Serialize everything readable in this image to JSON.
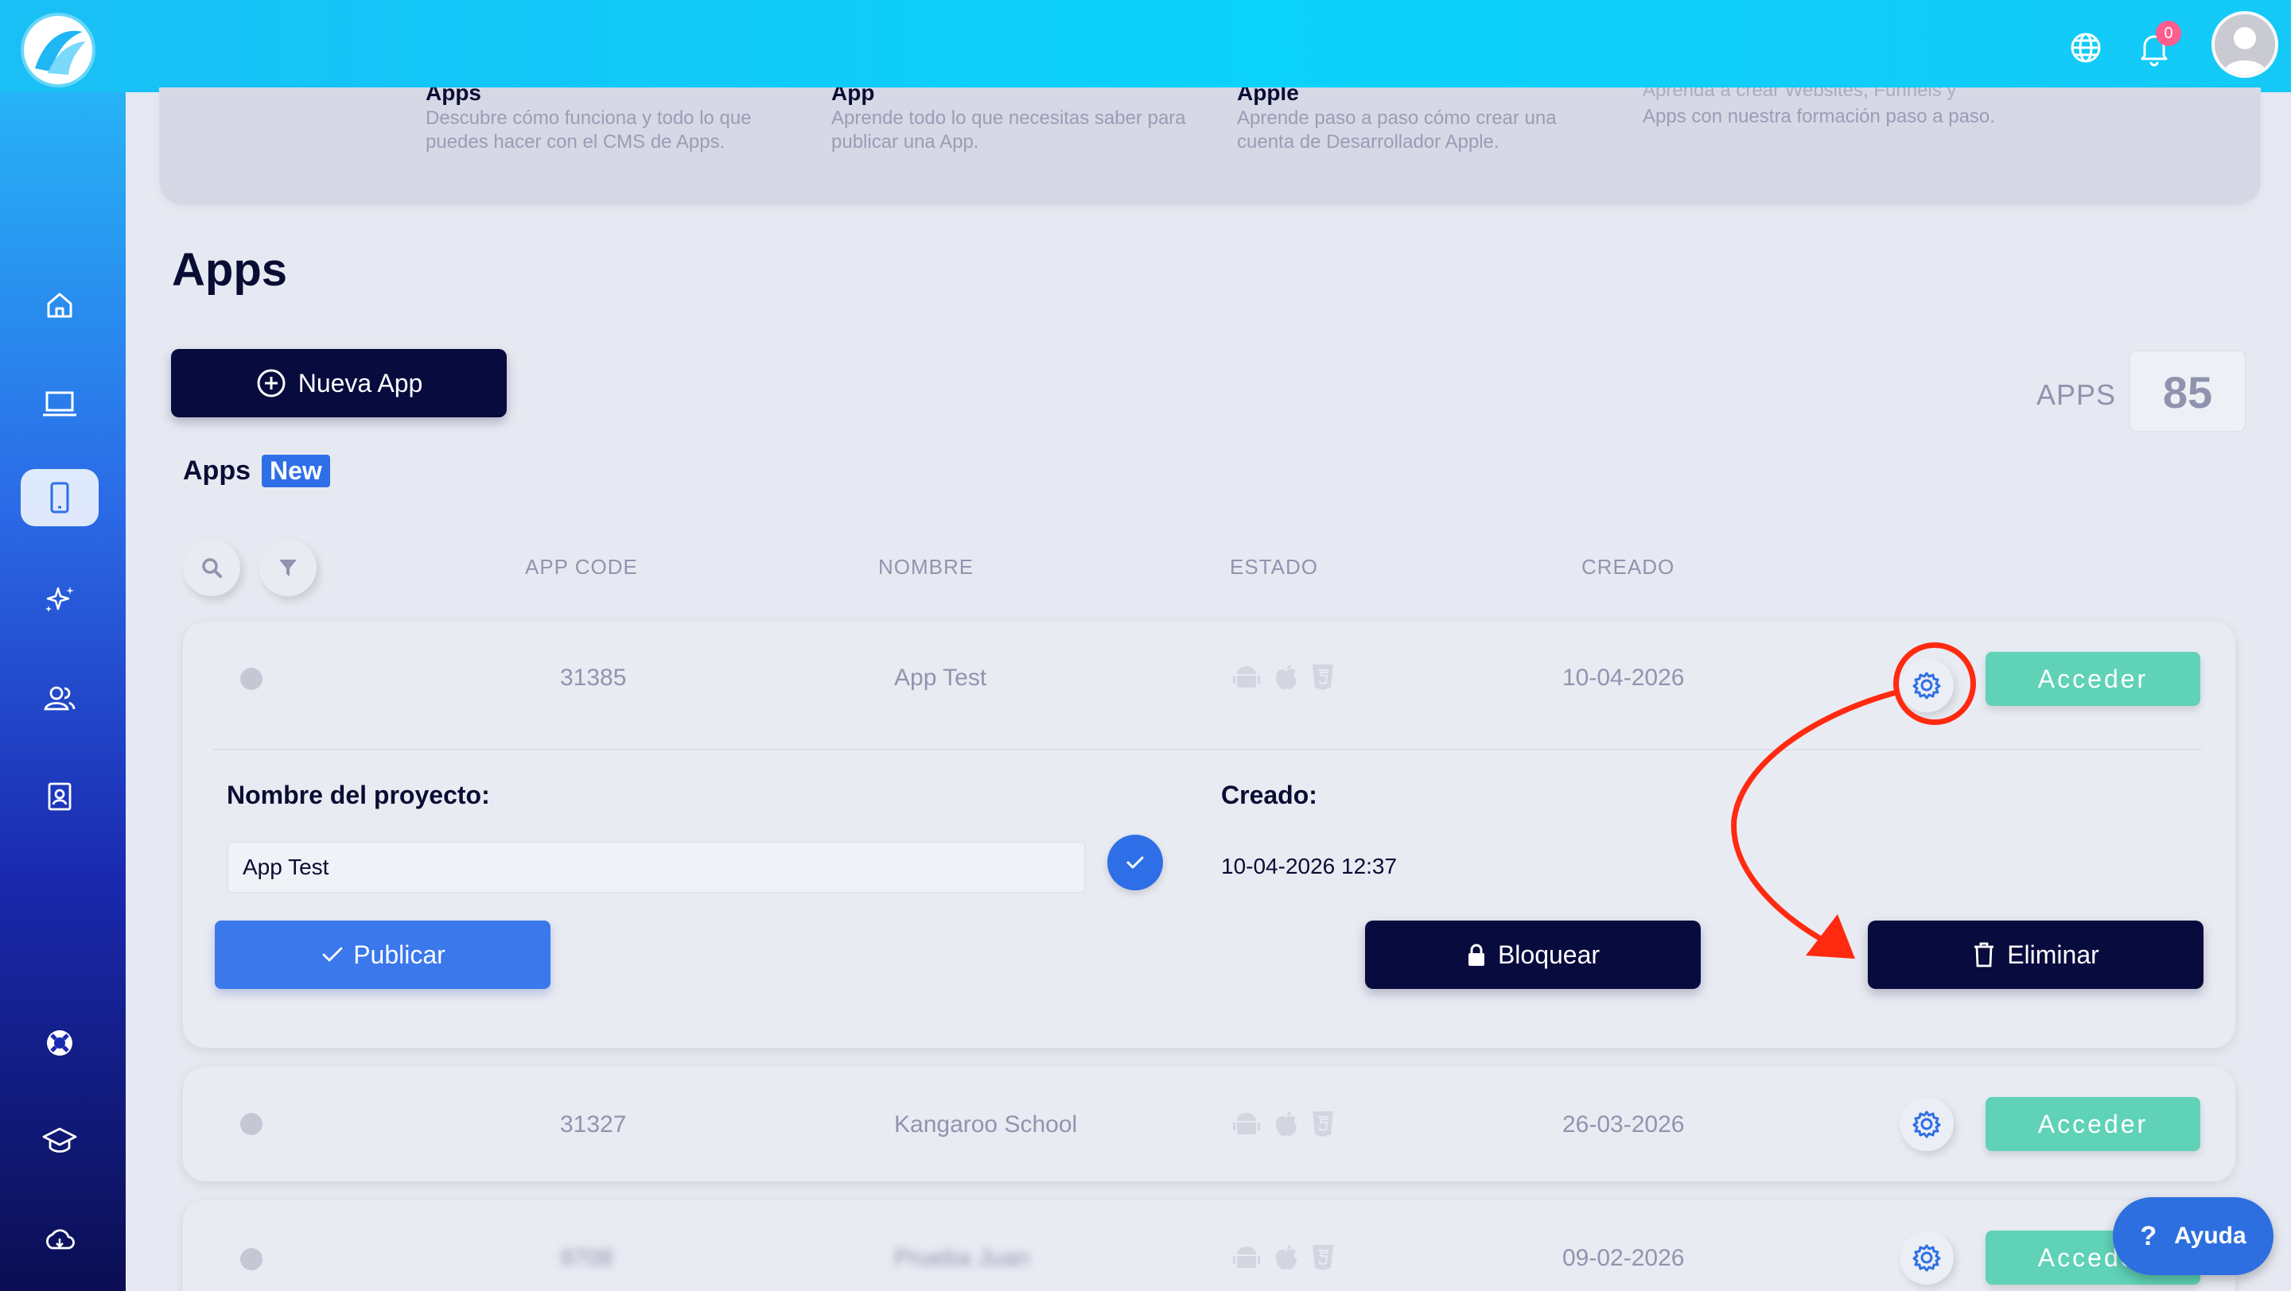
{
  "topbar": {
    "notifications_count": "0"
  },
  "sidebar": {
    "items": [
      {
        "name": "home"
      },
      {
        "name": "websites"
      },
      {
        "name": "apps"
      },
      {
        "name": "ai"
      },
      {
        "name": "users"
      },
      {
        "name": "contacts"
      },
      {
        "name": "support"
      },
      {
        "name": "academy"
      },
      {
        "name": "cloud"
      }
    ]
  },
  "tutorials": [
    {
      "title": "Apps",
      "desc": "Descubre cómo funciona y todo lo que puedes hacer con el CMS de Apps."
    },
    {
      "title": "App",
      "desc": "Aprende todo lo que necesitas saber para publicar una App."
    },
    {
      "title": "Apple",
      "desc": "Aprende paso a paso cómo crear una cuenta de Desarrollador Apple."
    },
    {
      "title": "Aprenda a crear Websites, Funnels y",
      "desc": "Apps con nuestra formación paso a paso."
    }
  ],
  "page": {
    "title": "Apps",
    "new_app_label": "Nueva App",
    "apps_counter_label": "APPS",
    "apps_counter_value": "85",
    "section_title": "Apps",
    "section_badge": "New"
  },
  "table": {
    "columns": [
      "APP CODE",
      "NOMBRE",
      "ESTADO",
      "CREADO"
    ],
    "rows": [
      {
        "code": "31385",
        "name": "App Test",
        "created": "10-04-2026",
        "access_label": "Acceder"
      },
      {
        "code": "31327",
        "name": "Kangaroo School",
        "created": "26-03-2026",
        "access_label": "Acceder"
      },
      {
        "code": "9708",
        "name": "Prueba Juan",
        "created": "09-02-2026",
        "access_label": "Acceder"
      }
    ]
  },
  "expanded": {
    "project_name_label": "Nombre del proyecto:",
    "project_name_value": "App Test",
    "created_label": "Creado:",
    "created_value": "10-04-2026 12:37",
    "publish_label": "Publicar",
    "block_label": "Bloquear",
    "delete_label": "Eliminar"
  },
  "help": {
    "label": "Ayuda"
  },
  "colors": {
    "accent_blue": "#3a78ec",
    "dark_navy": "#080b3d",
    "access_green": "#5fd2b7",
    "annotation_red": "#ff2a10"
  }
}
